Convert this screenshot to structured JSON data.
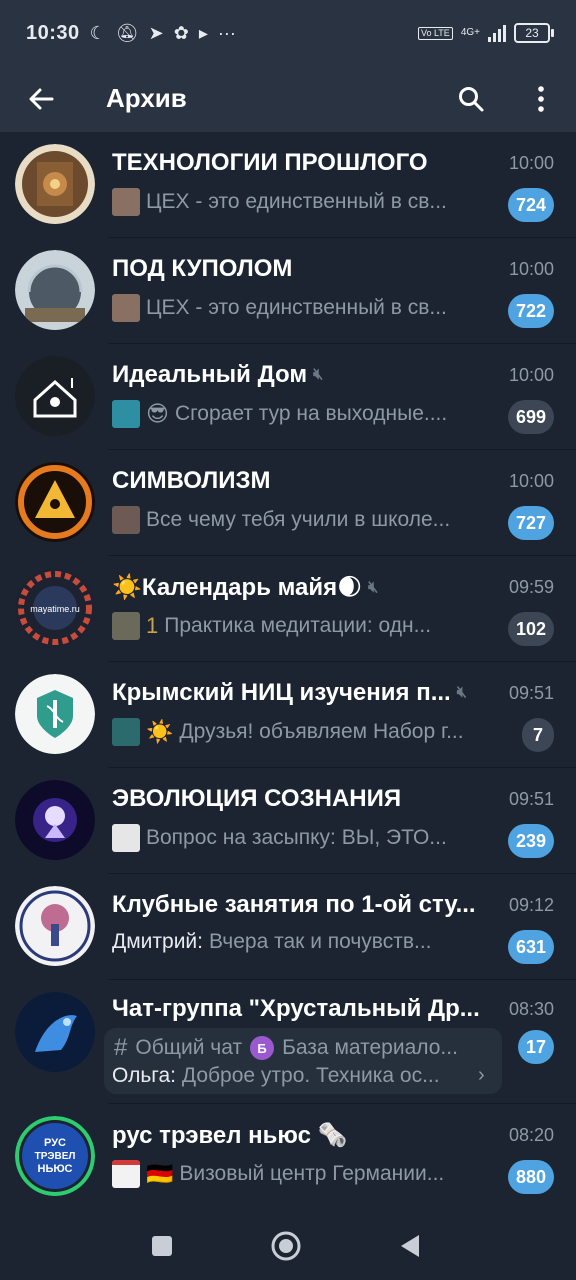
{
  "status": {
    "time": "10:30",
    "battery": "23",
    "network": "4G+",
    "volte": "Vo LTE",
    "more": "···"
  },
  "appbar": {
    "title": "Архив"
  },
  "chats": [
    {
      "name": "ТЕХНОЛОГИИ ПРОШЛОГО",
      "time": "10:00",
      "preview": "ЦЕХ - это единственный в св...",
      "badge": "724",
      "muted": false
    },
    {
      "name": "ПОД КУПОЛОМ",
      "time": "10:00",
      "preview": "ЦЕХ - это единственный в св...",
      "badge": "722",
      "muted": false
    },
    {
      "name": "Идеальный Дом",
      "time": "10:00",
      "preview_emoji": "😎",
      "preview": "Сгорает тур на выходные....",
      "badge": "699",
      "muted": true
    },
    {
      "name": "СИМВОЛИЗМ",
      "time": "10:00",
      "preview": "Все чему тебя учили в школе...",
      "badge": "727",
      "muted": false
    },
    {
      "name": "☀️Календарь майя🌒",
      "time": "09:59",
      "preview_emoji": "1",
      "preview": "Практика медитации: одн...",
      "badge": "102",
      "muted": true
    },
    {
      "name": "Крымский НИЦ изучения п...",
      "time": "09:51",
      "preview_emoji": "☀️",
      "preview": "Друзья! объявляем Набор г...",
      "badge": "7",
      "muted": true
    },
    {
      "name": "ЭВОЛЮЦИЯ СОЗНАНИЯ",
      "time": "09:51",
      "preview": "Вопрос на засыпку: ВЫ, ЭТО...",
      "badge": "239",
      "muted": false
    },
    {
      "name": "Клубные занятия по 1-ой сту...",
      "time": "09:12",
      "sender": "Дмитрий:",
      "preview": "Вчера так и почувств...",
      "badge": "631",
      "muted": false
    },
    {
      "name": "Чат-группа \"Хрустальный Др...",
      "time": "08:30",
      "topic1": "Общий чат",
      "topic2_letter": "Б",
      "topic2": "База материало...",
      "sender": "Ольга:",
      "preview": "Доброе утро. Техника ос...",
      "badge": "17",
      "muted": false
    },
    {
      "name": "рус трэвел ньюс 🗞️",
      "time": "08:20",
      "preview_emoji": "🇩🇪",
      "preview": "Визовый центр Германии...",
      "badge": "880",
      "muted": false
    }
  ],
  "avatar_labels": {
    "maya": "mayatime.ru",
    "rtn1": "РУС",
    "rtn2": "ТРЭВЕЛ",
    "rtn3": "НЬЮС"
  },
  "icons": {
    "back": "arrow-left-icon",
    "search": "search-icon",
    "more": "more-vertical-icon",
    "mute": "mute-icon"
  },
  "colors": {
    "header": "#2a3342",
    "background": "#1b2430",
    "badge_active": "#4fa3e0",
    "badge_muted": "#3c4654"
  }
}
